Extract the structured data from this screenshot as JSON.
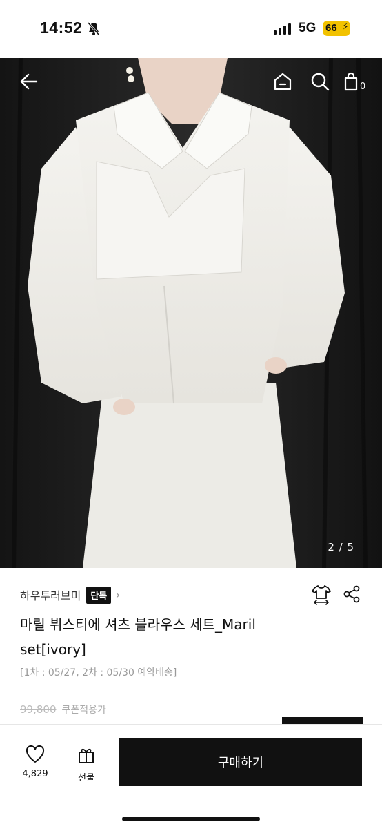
{
  "status_bar": {
    "time": "14:52",
    "network": "5G",
    "battery": "66",
    "icons": [
      "bell-slash-icon",
      "signal-icon",
      "battery-charging-icon"
    ]
  },
  "nav": {
    "icons": [
      "back-arrow-icon",
      "home-icon",
      "search-icon",
      "cart-icon"
    ],
    "cart_count": "0"
  },
  "gallery": {
    "page_indicator": "2 / 5"
  },
  "product": {
    "brand": "하우투러브미",
    "badge": "단독",
    "title": "마릴 뷔스티에 셔츠 블라우스 세트_Maril set[ivory]",
    "shipping_note": "[1차 : 05/27, 2차 : 05/30 예약배송]",
    "original_price": "99,800",
    "coupon_label": "쿠폰적용가",
    "icons": [
      "size-guide-icon",
      "share-icon"
    ]
  },
  "bottom_bar": {
    "like_count": "4,829",
    "gift_label": "선물",
    "buy_label": "구매하기",
    "icons": [
      "heart-icon",
      "gift-icon"
    ]
  }
}
